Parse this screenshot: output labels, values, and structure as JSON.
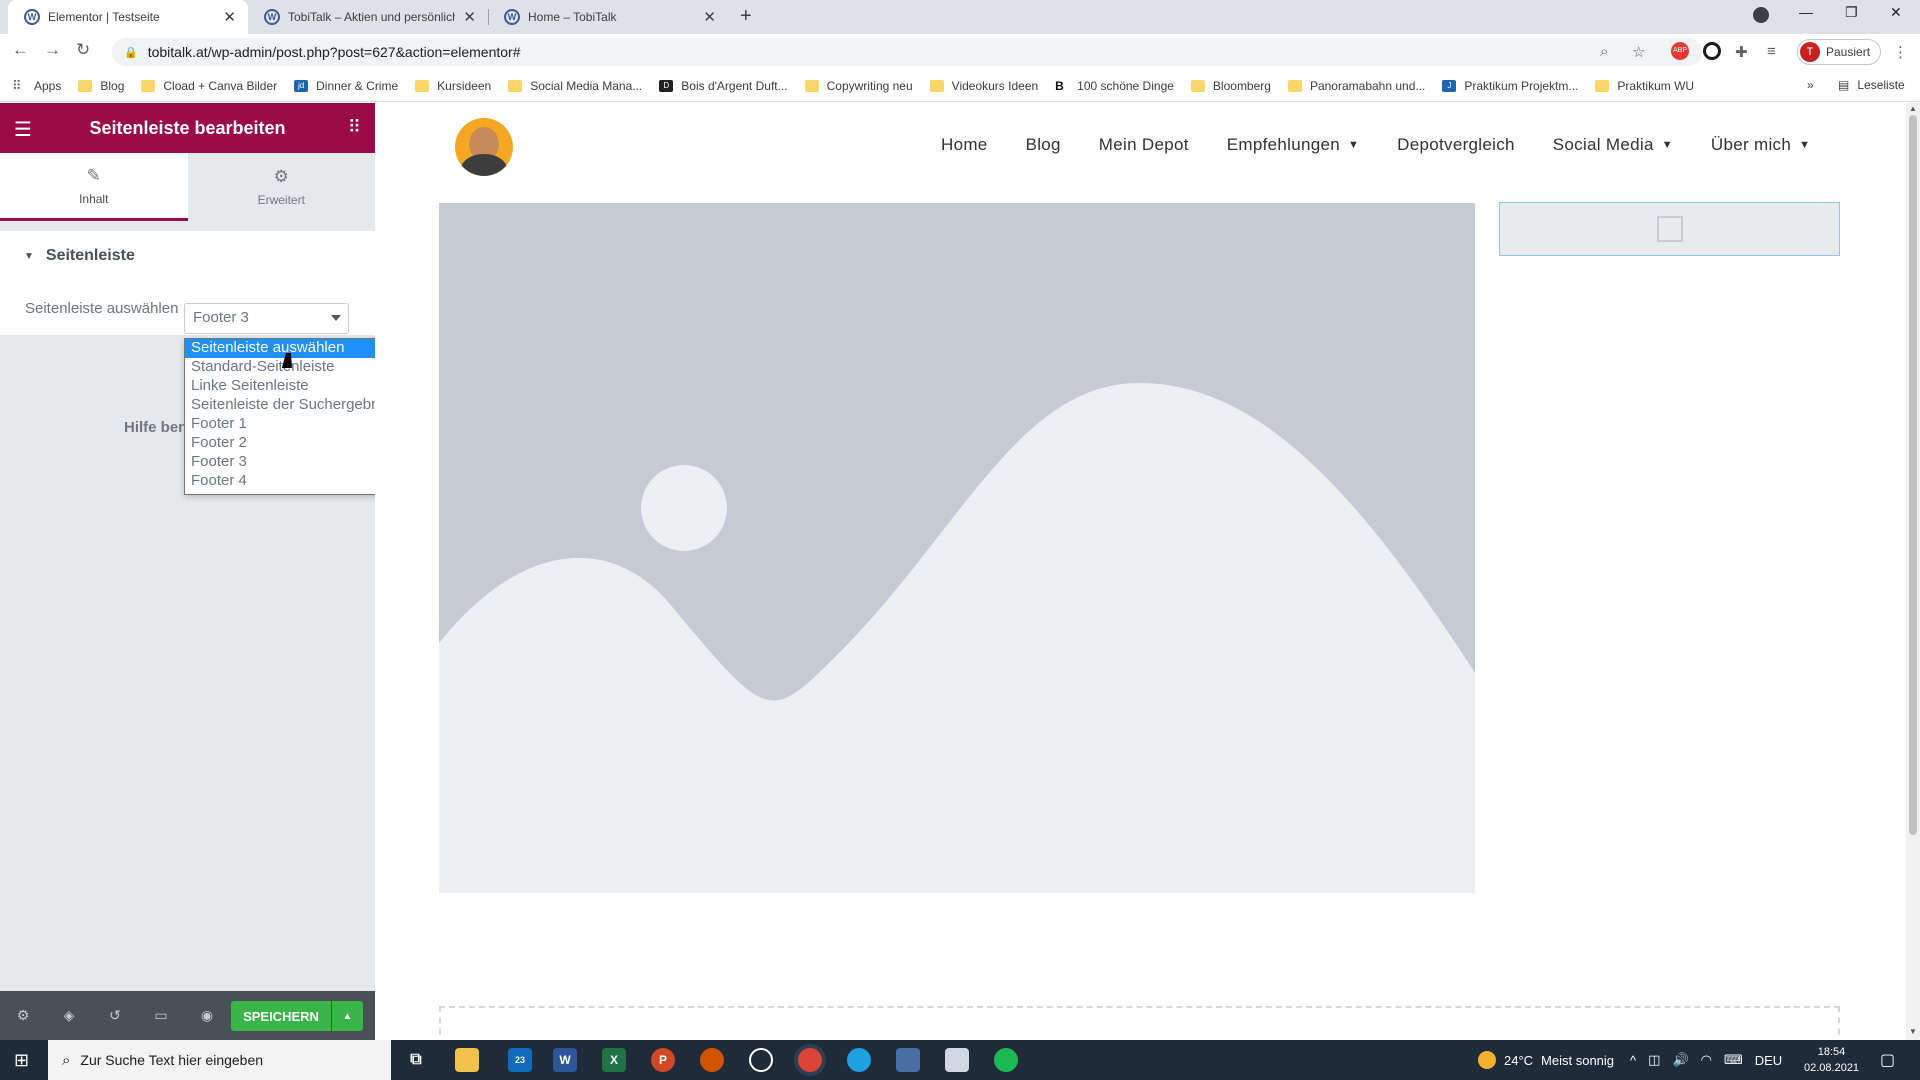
{
  "browser": {
    "tabs": [
      {
        "title": "Elementor | Testseite",
        "active": true
      },
      {
        "title": "TobiTalk – Aktien und persönlich",
        "active": false
      },
      {
        "title": "Home – TobiTalk",
        "active": false
      }
    ],
    "url": "tobitalk.at/wp-admin/post.php?post=627&action=elementor#",
    "profile_label": "Pausiert",
    "profile_initial": "T",
    "bookmarks": [
      {
        "label": "Apps",
        "icon": "apps-grid-icon"
      },
      {
        "label": "Blog",
        "icon": "folder-icon"
      },
      {
        "label": "Cload + Canva Bilder",
        "icon": "folder-icon"
      },
      {
        "label": "Dinner & Crime",
        "icon": "jd-icon"
      },
      {
        "label": "Kursideen",
        "icon": "folder-icon"
      },
      {
        "label": "Social Media Mana...",
        "icon": "folder-icon"
      },
      {
        "label": "Bois d'Argent Duft...",
        "icon": "bois-icon"
      },
      {
        "label": "Copywriting neu",
        "icon": "folder-icon"
      },
      {
        "label": "Videokurs Ideen",
        "icon": "folder-icon"
      },
      {
        "label": "100 schöne Dinge",
        "icon": "b-icon"
      },
      {
        "label": "Bloomberg",
        "icon": "folder-icon"
      },
      {
        "label": "Panoramabahn und...",
        "icon": "folder-icon"
      },
      {
        "label": "Praktikum Projektm...",
        "icon": "j-icon"
      },
      {
        "label": "Praktikum WU",
        "icon": "folder-icon"
      }
    ],
    "bookmarks_more": "»",
    "reading_list": "Leseliste"
  },
  "elementor": {
    "header_title": "Seitenleiste bearbeiten",
    "tabs": [
      {
        "label": "Inhalt",
        "icon": "pencil-icon"
      },
      {
        "label": "Erweitert",
        "icon": "gear-icon"
      }
    ],
    "section_title": "Seitenleiste",
    "control_label": "Seitenleiste auswählen",
    "select_value": "Footer 3",
    "dropdown_options": [
      "Seitenleiste auswählen",
      "Standard-Seitenleiste",
      "Linke Seitenleiste",
      "Seitenleiste der Suchergebnisse",
      "Footer 1",
      "Footer 2",
      "Footer 3",
      "Footer 4"
    ],
    "dropdown_highlighted": "Seitenleiste auswählen",
    "help_text_visible": "Hilfe ben",
    "save_label": "SPEICHERN"
  },
  "site": {
    "nav": [
      {
        "label": "Home",
        "dropdown": false
      },
      {
        "label": "Blog",
        "dropdown": false
      },
      {
        "label": "Mein Depot",
        "dropdown": false
      },
      {
        "label": "Empfehlungen",
        "dropdown": true
      },
      {
        "label": "Depotvergleich",
        "dropdown": false
      },
      {
        "label": "Social Media",
        "dropdown": true
      },
      {
        "label": "Über mich",
        "dropdown": true
      }
    ]
  },
  "taskbar": {
    "search_placeholder": "Zur Suche Text hier eingeben",
    "weather_temp": "24°C",
    "weather_text": "Meist sonnig",
    "language": "DEU",
    "time": "18:54",
    "date": "02.08.2021",
    "mail_badge": "23"
  },
  "colors": {
    "elementor_brand": "#9b0a46",
    "save_green": "#39b54a",
    "dropdown_highlight": "#1e90ff",
    "placeholder_gray": "#c4cbd4"
  }
}
